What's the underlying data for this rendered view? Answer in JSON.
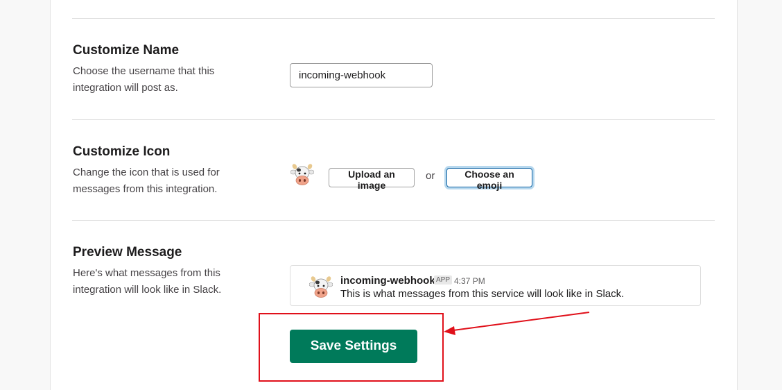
{
  "sections": {
    "name": {
      "title": "Customize Name",
      "description": "Choose the username that this integration will post as.",
      "input_value": "incoming-webhook"
    },
    "icon": {
      "title": "Customize Icon",
      "description": "Change the icon that is used for messages from this integration.",
      "icon": "cow-emoji-icon",
      "upload_label": "Upload an image",
      "or_label": "or",
      "emoji_label": "Choose an emoji"
    },
    "preview": {
      "title": "Preview Message",
      "description": "Here's what messages from this integration will look like in Slack.",
      "username": "incoming-webhook",
      "badge": "APP",
      "time": "4:37 PM",
      "message": "This is what messages from this service will look like in Slack."
    }
  },
  "save_label": "Save Settings",
  "colors": {
    "save_button": "#007a5a",
    "annotation": "#e0101a",
    "focus_ring": "#1264a3"
  }
}
